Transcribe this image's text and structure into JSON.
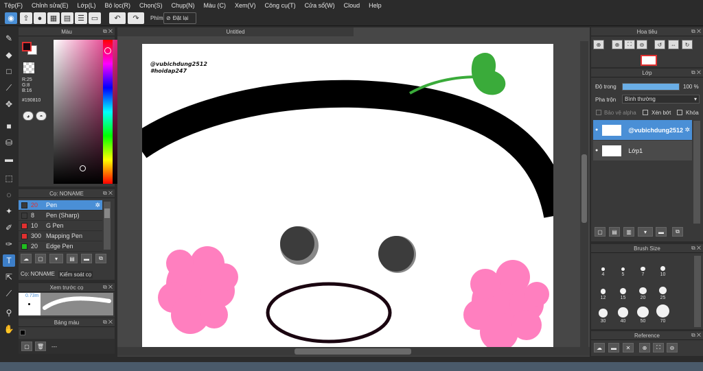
{
  "menu": [
    "Tệp(F)",
    "Chỉnh sửa(E)",
    "Lớp(L)",
    "Bộ lọc(R)",
    "Chọn(S)",
    "Chụp(N)",
    "Màu (C)",
    "Xem(V)",
    "Công cụ(T)",
    "Cửa sổ(W)",
    "Cloud",
    "Help"
  ],
  "toolbar": {
    "phim_label": "Phím",
    "reset_label": "Đặt lại"
  },
  "color_panel": {
    "title": "Màu",
    "r": "R:25",
    "g": "G:8",
    "b": "B:16",
    "hex": "#190810",
    "fg_color": "#190810",
    "bg_color": "#ffffff"
  },
  "brush_panel": {
    "title": "Cọ: NONAME",
    "brushes": [
      {
        "size": "20",
        "name": "Pen",
        "color": "#3a3a3a"
      },
      {
        "size": "8",
        "name": "Pen (Sharp)",
        "color": "#3a3a3a"
      },
      {
        "size": "10",
        "name": "G Pen",
        "color": "#e03030"
      },
      {
        "size": "300",
        "name": "Mapping Pen",
        "color": "#e03030"
      },
      {
        "size": "20",
        "name": "Edge Pen",
        "color": "#1fbf1f"
      }
    ],
    "tab_noname": "Cọ: NONAME",
    "tab_control": "Kiểm soát cọ"
  },
  "preview_panel": {
    "title": "Xem trước cọ",
    "size_value": "0.73m"
  },
  "palette_panel": {
    "title": "Bảng màu",
    "footer_text": "---"
  },
  "document": {
    "tab_title": "Untitled"
  },
  "canvas_text": {
    "line1": "@vubichdung2512",
    "line2": "#hoidap247"
  },
  "navigator": {
    "title": "Hoa tiêu"
  },
  "layer_panel": {
    "title": "Lớp",
    "opacity_label": "Độ trong",
    "opacity_value": "100 %",
    "opacity_fraction": 1.0,
    "blend_label": "Pha trộn",
    "blend_value": "Bình thường",
    "protect_alpha": "Bảo vệ alpha",
    "clipping": "Xén bớt",
    "lock": "Khóa",
    "layers": [
      {
        "name": "@vubichdung2512",
        "selected": true
      },
      {
        "name": "Lớp1",
        "selected": false
      }
    ]
  },
  "brush_size_panel": {
    "title": "Brush Size",
    "sizes": [
      "4",
      "5",
      "7",
      "10",
      "12",
      "15",
      "20",
      "25",
      "30",
      "40",
      "50",
      "70"
    ]
  },
  "reference_panel": {
    "title": "Reference"
  }
}
